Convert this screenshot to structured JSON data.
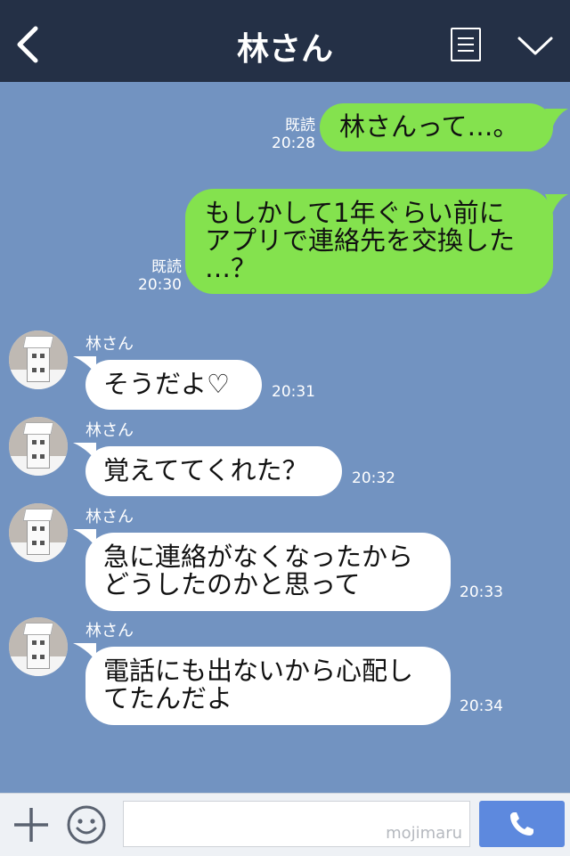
{
  "header": {
    "title": "林さん"
  },
  "colors": {
    "header_bg": "#243046",
    "chat_bg": "#7293c1",
    "sent_bubble": "#84e24e",
    "received_bubble": "#ffffff",
    "call_button": "#5d89de"
  },
  "icons": {
    "back": "chevron-left-icon",
    "menu": "menu-icon",
    "collapse": "chevron-down-icon",
    "add": "plus-icon",
    "sticker": "smiley-icon",
    "call": "phone-icon"
  },
  "messages": [
    {
      "side": "sent",
      "status": "既読",
      "time": "20:28",
      "lines": [
        "林さんって…。"
      ]
    },
    {
      "side": "sent",
      "status": "既読",
      "time": "20:30",
      "lines": [
        "もしかして1年ぐらい前に",
        "アプリで連絡先を交換した",
        "…？"
      ]
    },
    {
      "side": "received",
      "sender": "林さん",
      "time": "20:31",
      "lines": [
        "そうだよ♡"
      ]
    },
    {
      "side": "received",
      "sender": "林さん",
      "time": "20:32",
      "lines": [
        "覚えててくれた？"
      ]
    },
    {
      "side": "received",
      "sender": "林さん",
      "time": "20:33",
      "lines": [
        "急に連絡がなくなったから",
        "どうしたのかと思って"
      ]
    },
    {
      "side": "received",
      "sender": "林さん",
      "time": "20:34",
      "lines": [
        "電話にも出ないから心配し",
        "てたんだよ"
      ]
    }
  ],
  "input": {
    "value": "",
    "watermark": "mojimaru"
  }
}
